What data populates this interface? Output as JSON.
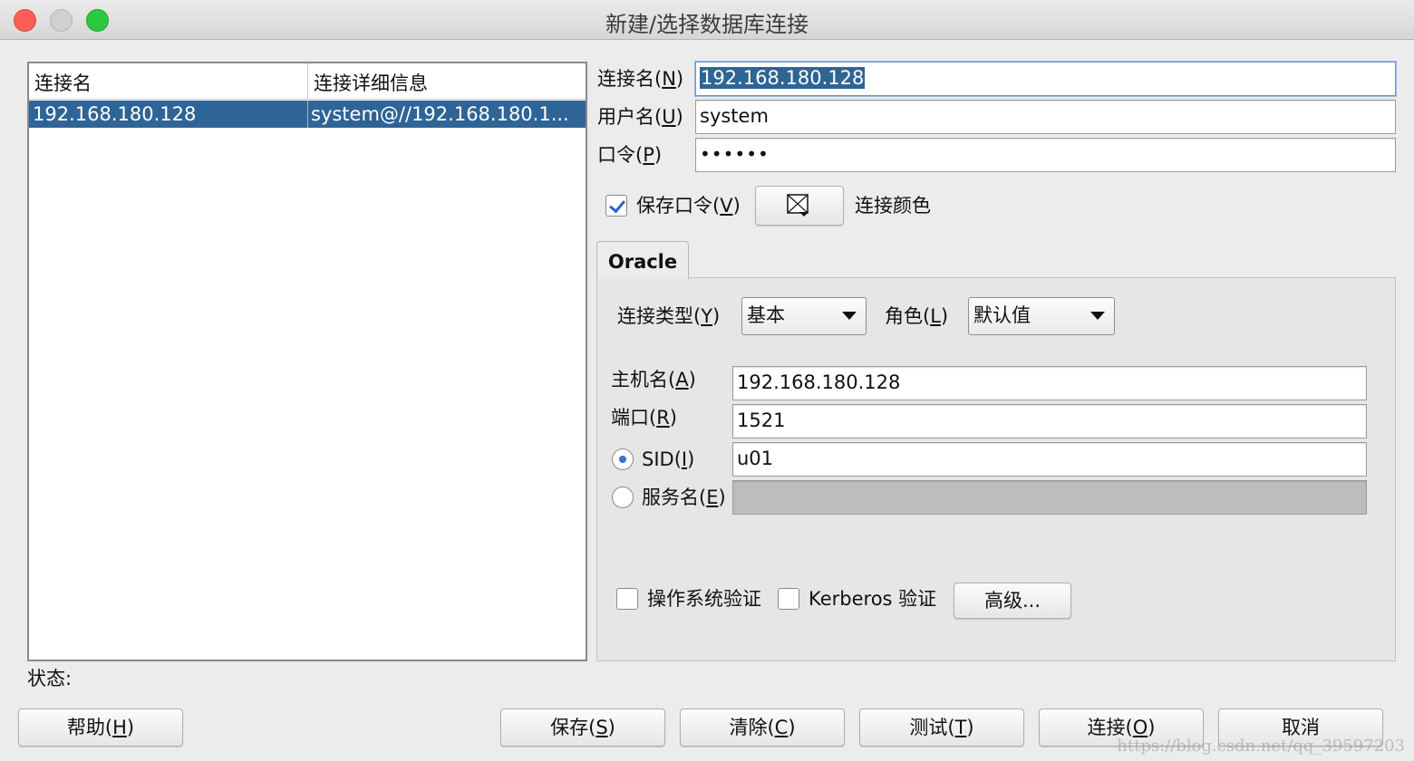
{
  "window": {
    "title": "新建/选择数据库连接"
  },
  "connections_table": {
    "columns": [
      "连接名",
      "连接详细信息"
    ],
    "rows": [
      {
        "name": "192.168.180.128",
        "details": "system@//192.168.180.1..."
      }
    ]
  },
  "form": {
    "conn_name_label": "连接名(",
    "conn_name_key": "N",
    "conn_name_value": "192.168.180.128",
    "user_label": "用户名(",
    "user_key": "U",
    "user_value": "system",
    "password_label": "口令(",
    "password_key": "P",
    "password_value": "••••••",
    "save_password_label": "保存口令(",
    "save_password_key": "V",
    "save_password_checked": true,
    "conn_color_label": "连接颜色",
    "conn_color_icon": "no-color-icon"
  },
  "tabs": {
    "oracle": "Oracle"
  },
  "oracle": {
    "conn_type_label": "连接类型(",
    "conn_type_key": "Y",
    "conn_type_value": "基本",
    "role_label": "角色(",
    "role_key": "L",
    "role_value": "默认值",
    "host_label": "主机名(",
    "host_key": "A",
    "host_value": "192.168.180.128",
    "port_label": "端口(",
    "port_key": "R",
    "port_value": "1521",
    "sid_label": "SID(",
    "sid_key": "I",
    "sid_value": "u01",
    "sid_selected": true,
    "service_label": "服务名(",
    "service_key": "E",
    "service_value": "",
    "os_auth_label": "操作系统验证",
    "kerberos_label": "Kerberos 验证",
    "advanced_label": "高级..."
  },
  "status": {
    "label": "状态:"
  },
  "buttons": {
    "help": {
      "text": "帮助(",
      "key": "H"
    },
    "save": {
      "text": "保存(",
      "key": "S"
    },
    "clear": {
      "text": "清除(",
      "key": "C"
    },
    "test": {
      "text": "测试(",
      "key": "T"
    },
    "connect": {
      "text": "连接(",
      "key": "O"
    },
    "cancel": {
      "text": "取消"
    }
  },
  "watermark": "https://blog.csdn.net/qq_39597203"
}
